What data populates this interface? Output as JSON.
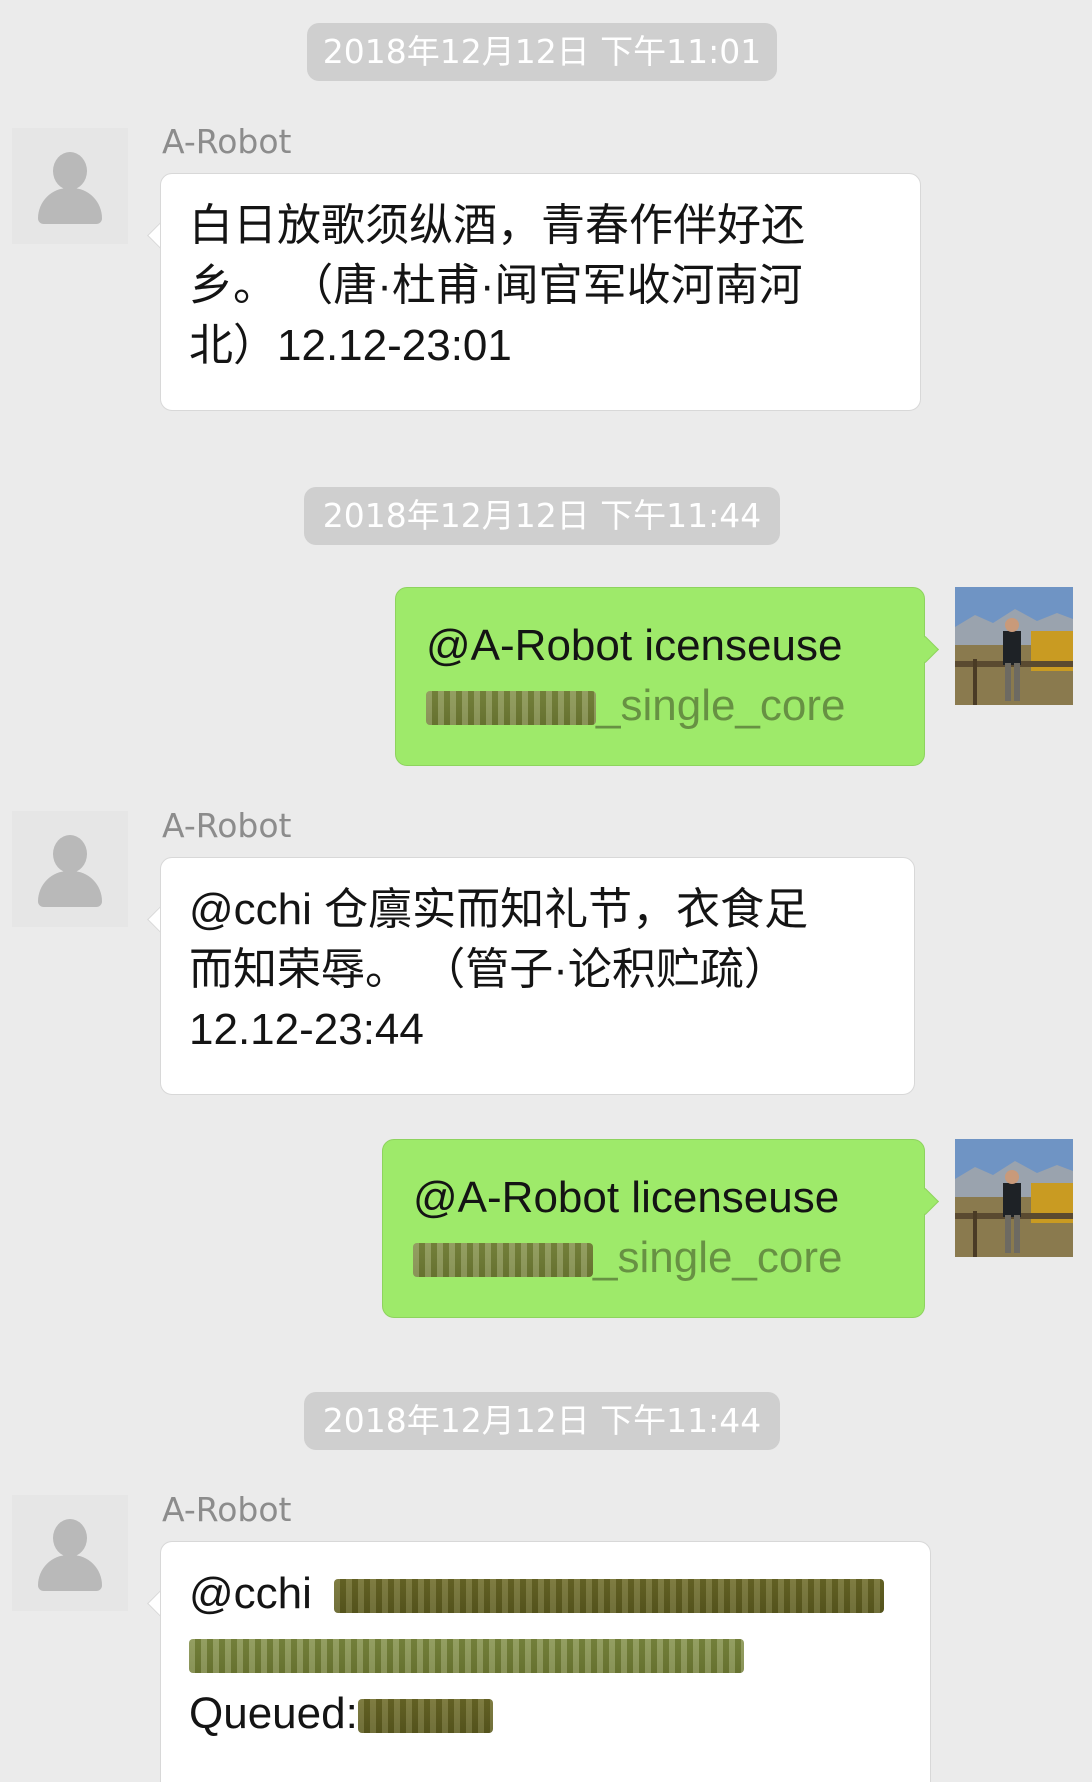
{
  "messages": [
    {
      "kind": "timestamp",
      "text": "2018年12月12日 下午11:01"
    },
    {
      "kind": "incoming",
      "sender": "A-Robot",
      "lines": [
        "白日放歌须纵酒，青春作伴好还",
        "乡。 （唐·杜甫·闻官军收河南河",
        "北）12.12-23:01"
      ]
    },
    {
      "kind": "timestamp",
      "text": "2018年12月12日 下午11:44"
    },
    {
      "kind": "outgoing",
      "line1": "@A-Robot icenseuse",
      "line2_visible": "_single_core"
    },
    {
      "kind": "incoming",
      "sender": "A-Robot",
      "lines": [
        "@cchi 仓廪实而知礼节，衣食足",
        "而知荣辱。 （管子·论积贮疏）",
        "12.12-23:44"
      ]
    },
    {
      "kind": "outgoing",
      "line1": "@A-Robot licenseuse",
      "line2_visible": "_single_core"
    },
    {
      "kind": "timestamp",
      "text": "2018年12月12日 下午11:44"
    },
    {
      "kind": "incoming",
      "sender": "A-Robot",
      "line1": "@cchi",
      "line3": "Queued:"
    }
  ],
  "icons": {
    "default_avatar": "person-silhouette-icon",
    "user_avatar": "mountain-photo-avatar"
  },
  "colors": {
    "background": "#ebebeb",
    "timestamp_bg": "#cfcfcf",
    "incoming_bubble": "#ffffff",
    "outgoing_bubble": "#9eea6a",
    "sender_name": "#8c8c8c"
  }
}
